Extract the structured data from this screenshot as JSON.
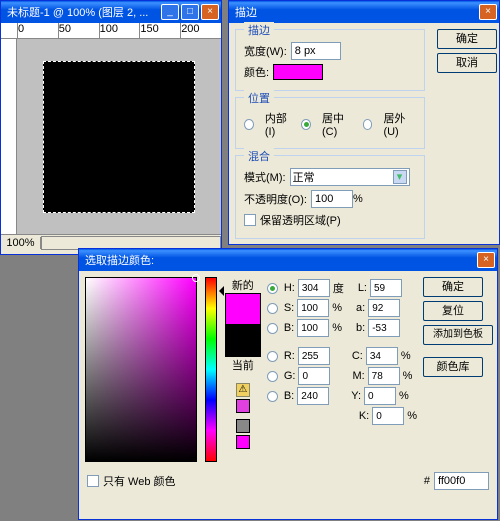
{
  "doc": {
    "title": "未标题-1 @ 100% (图层 2, ...",
    "zoom": "100%",
    "r0": "0",
    "r50": "50",
    "r100": "100",
    "r150": "150",
    "r200": "200"
  },
  "stroke": {
    "title": "描边",
    "g1": "描边",
    "width_lbl": "宽度(W):",
    "width_val": "8 px",
    "color_lbl": "颜色:",
    "g2": "位置",
    "pos_in": "内部(I)",
    "pos_ctr": "居中(C)",
    "pos_out": "居外(U)",
    "g3": "混合",
    "mode_lbl": "模式(M):",
    "mode_val": "正常",
    "opacity_lbl": "不透明度(O):",
    "opacity_val": "100",
    "pct": "%",
    "preserve": "保留透明区域(P)",
    "ok": "确定",
    "cancel": "取消"
  },
  "cp": {
    "title": "选取描边颜色:",
    "new": "新的",
    "current": "当前",
    "ok": "确定",
    "reset": "复位",
    "add": "添加到色板",
    "lib": "颜色库",
    "H": "H:",
    "Hv": "304",
    "deg": "度",
    "S": "S:",
    "Sv": "100",
    "B": "B:",
    "Bv": "100",
    "R": "R:",
    "Rv": "255",
    "G": "G:",
    "Gv": "0",
    "Bb": "B:",
    "Bbv": "240",
    "L": "L:",
    "Lv": "59",
    "a": "a:",
    "av": "92",
    "b": "b:",
    "bv": "-53",
    "C": "C:",
    "Cv": "34",
    "M": "M:",
    "Mv": "78",
    "Y": "Y:",
    "Yv": "0",
    "K": "K:",
    "Kv": "0",
    "pct": "%",
    "hash": "#",
    "hex": "ff00f0",
    "web": "只有 Web 颜色"
  }
}
